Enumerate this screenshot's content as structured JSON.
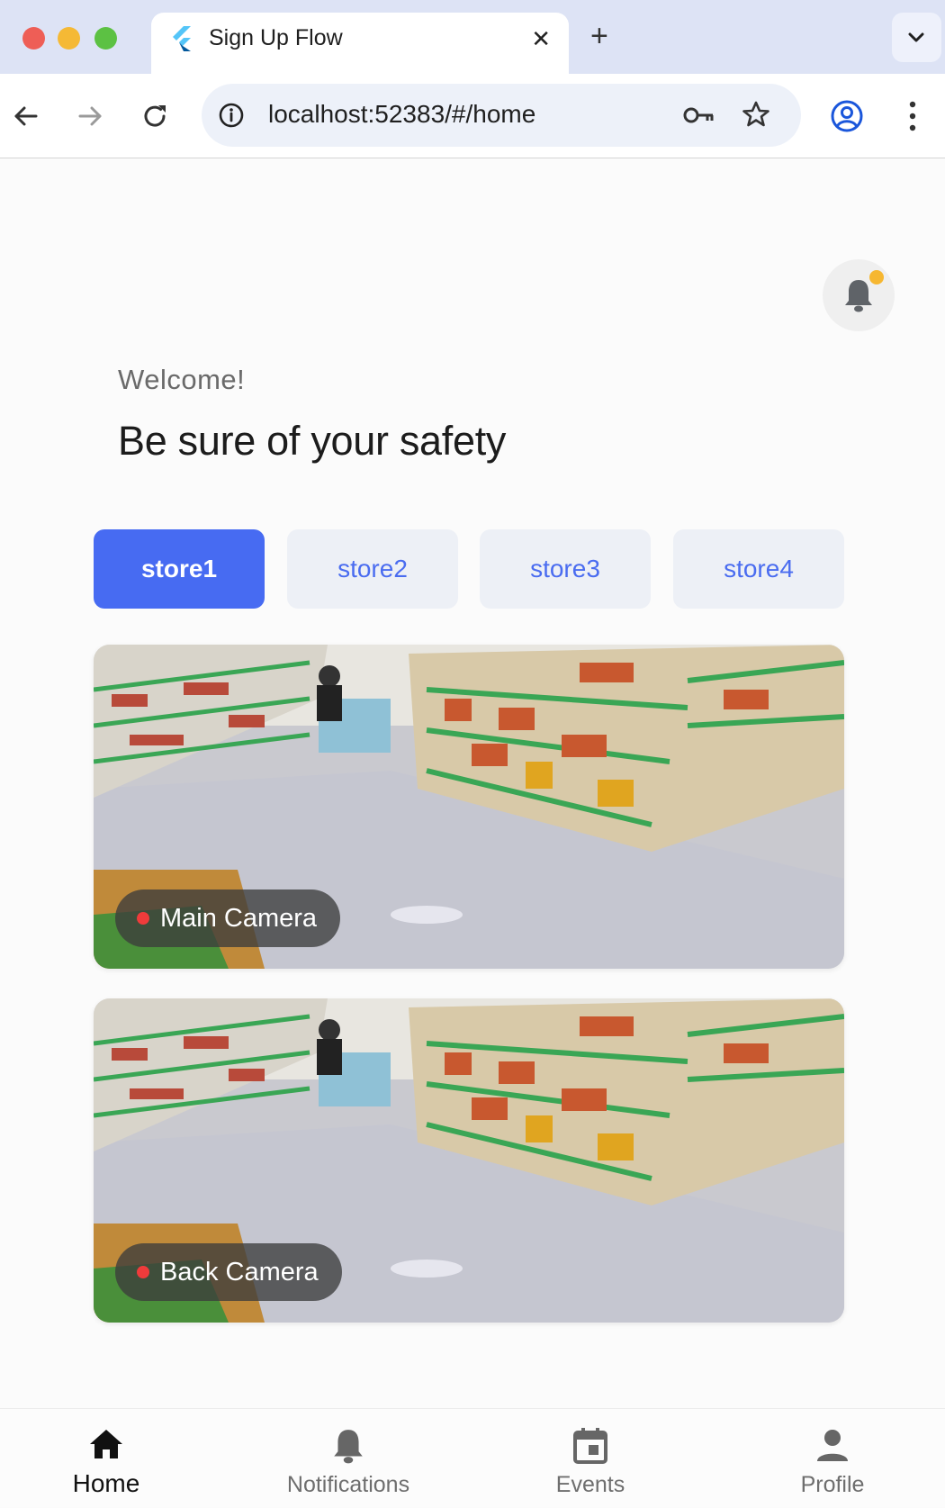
{
  "browser": {
    "tab_title": "Sign Up Flow",
    "tab_close": "✕",
    "new_tab": "+",
    "url": "localhost:52383/#/home"
  },
  "header": {
    "welcome": "Welcome!",
    "headline": "Be sure of your safety",
    "notification_badge_color": "#f6b731"
  },
  "stores": [
    {
      "label": "store1",
      "selected": true
    },
    {
      "label": "store2",
      "selected": false
    },
    {
      "label": "store3",
      "selected": false
    },
    {
      "label": "store4",
      "selected": false
    }
  ],
  "cameras": [
    {
      "label": "Main Camera",
      "status_color": "#ef3b3b"
    },
    {
      "label": "Back Camera",
      "status_color": "#ef3b3b"
    }
  ],
  "bottom_nav": [
    {
      "label": "Home",
      "icon": "home-icon",
      "active": true
    },
    {
      "label": "Notifications",
      "icon": "bell-icon",
      "active": false
    },
    {
      "label": "Events",
      "icon": "calendar-icon",
      "active": false
    },
    {
      "label": "Profile",
      "icon": "person-icon",
      "active": false
    }
  ],
  "colors": {
    "accent": "#476bf2",
    "chip_bg": "#edf0f6",
    "chip_text": "#4a6cf0"
  }
}
